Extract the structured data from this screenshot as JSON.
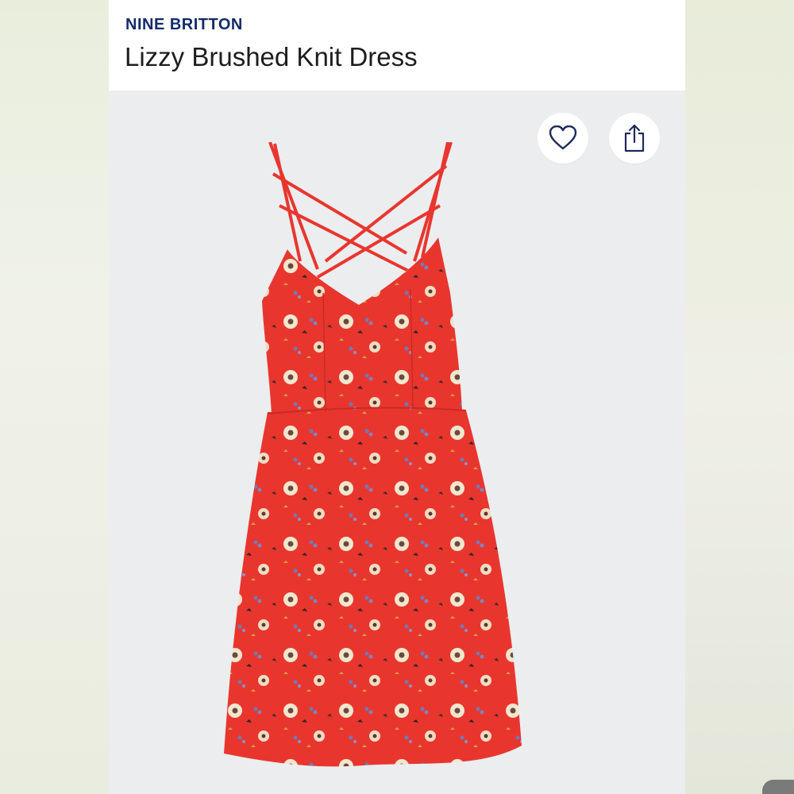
{
  "product": {
    "brand": "NINE BRITTON",
    "title": "Lizzy Brushed Knit Dress"
  },
  "actions": {
    "favorite_icon": "heart-icon",
    "share_icon": "share-icon"
  },
  "image": {
    "subject": "dress-photo"
  },
  "colors": {
    "brand_text": "#142a6b",
    "dress_red": "#e8362e",
    "background": "#ecedef"
  }
}
